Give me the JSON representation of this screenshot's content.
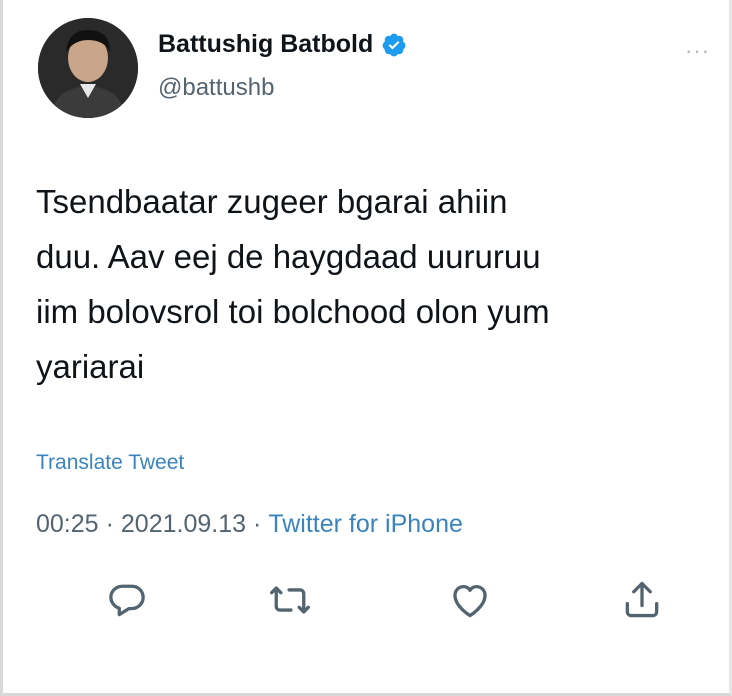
{
  "author": {
    "name": "Battushig Batbold",
    "handle": "@battushb",
    "verified": true,
    "avatar_icon": "avatar-photo"
  },
  "tweet": {
    "text": "Tsendbaatar zugeer bgarai ahiin\nduu. Aav eej de haygdaad uururuu\niim bolovsrol toi bolchood olon yum\nyariarai",
    "translate_label": "Translate Tweet",
    "time": "00:25",
    "separator": "·",
    "date": "2021.09.13",
    "source": "Twitter for iPhone"
  },
  "more_menu": "···",
  "actions": [
    {
      "icon": "reply-icon"
    },
    {
      "icon": "retweet-icon"
    },
    {
      "icon": "like-icon"
    },
    {
      "icon": "share-icon"
    }
  ],
  "colors": {
    "link": "#3a84bd",
    "secondary": "#536471",
    "verified": "#1d9bf0",
    "text": "#0f1419"
  }
}
